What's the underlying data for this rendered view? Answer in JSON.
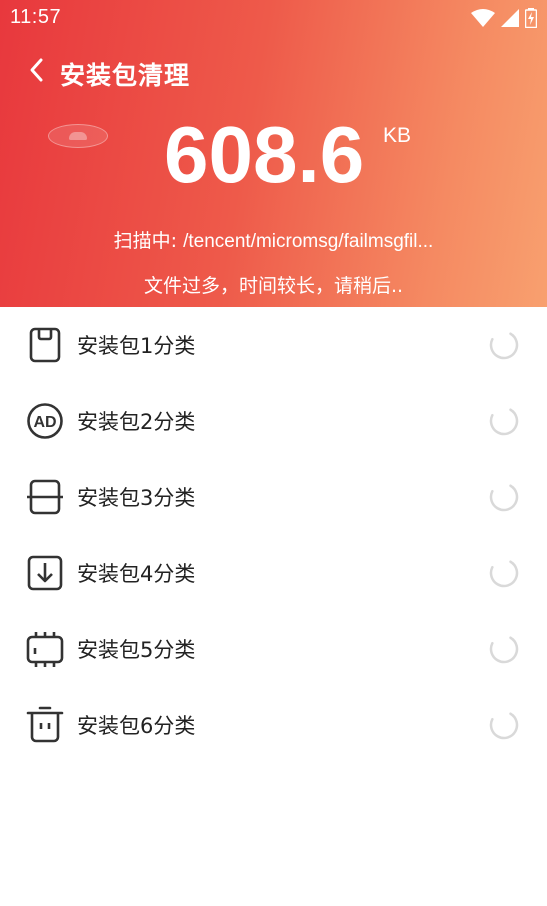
{
  "status_bar": {
    "time": "11:57",
    "icons": [
      "wifi-icon",
      "signal-icon",
      "battery-charging-icon"
    ]
  },
  "header": {
    "back_icon": "chevron-left-icon",
    "title": "安装包清理",
    "size_value": "608.6",
    "size_unit": "KB",
    "scan_label": "扫描中: ",
    "scan_path": "/tencent/micromsg/failmsgfil...",
    "hint": "文件过多，时间较长，请稍后.."
  },
  "categories": [
    {
      "label": "安装包1分类",
      "icon": "sd-card-icon"
    },
    {
      "label": "安装包2分类",
      "icon": "ad-icon"
    },
    {
      "label": "安装包3分类",
      "icon": "square-divider-icon"
    },
    {
      "label": "安装包4分类",
      "icon": "download-box-icon"
    },
    {
      "label": "安装包5分类",
      "icon": "chip-icon"
    },
    {
      "label": "安装包6分类",
      "icon": "trash-bin-icon"
    }
  ],
  "colors": {
    "header_gradient_start": "#e8383d",
    "header_gradient_end": "#f8a06f",
    "list_text": "#222222",
    "spinner": "#cccccc"
  }
}
